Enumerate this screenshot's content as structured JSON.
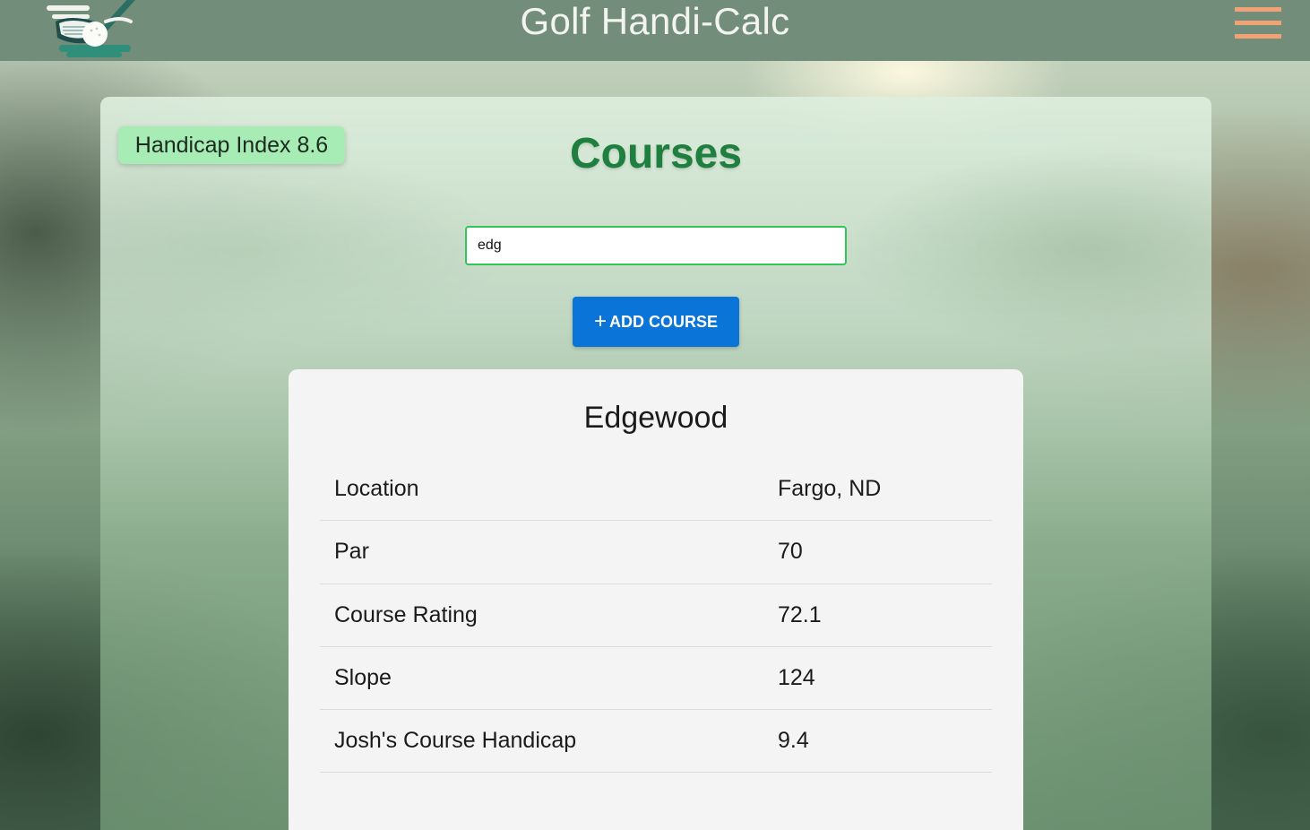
{
  "header": {
    "title": "Golf Handi-Calc",
    "logo_icon": "golf-club-ball-logo-icon",
    "menu_icon": "hamburger-menu-icon",
    "menu_color": "#f0a274"
  },
  "main": {
    "handicap_badge": "Handicap Index 8.6",
    "page_title": "Courses",
    "search": {
      "value": "edg",
      "placeholder": ""
    },
    "add_button": {
      "icon": "plus-icon",
      "icon_glyph": "+",
      "label": "ADD COURSE"
    }
  },
  "course": {
    "name": "Edgewood",
    "rows": [
      {
        "label": "Location",
        "value": "Fargo, ND"
      },
      {
        "label": "Par",
        "value": "70"
      },
      {
        "label": "Course Rating",
        "value": "72.1"
      },
      {
        "label": "Slope",
        "value": "124"
      },
      {
        "label": "Josh's Course Handicap",
        "value": "9.4"
      }
    ]
  },
  "colors": {
    "header_bg": "#728e7a",
    "title_green": "#1f7f3e",
    "badge_bg": "#a6ecb4",
    "button_blue": "#0a74d8",
    "input_border": "#33c45a"
  }
}
